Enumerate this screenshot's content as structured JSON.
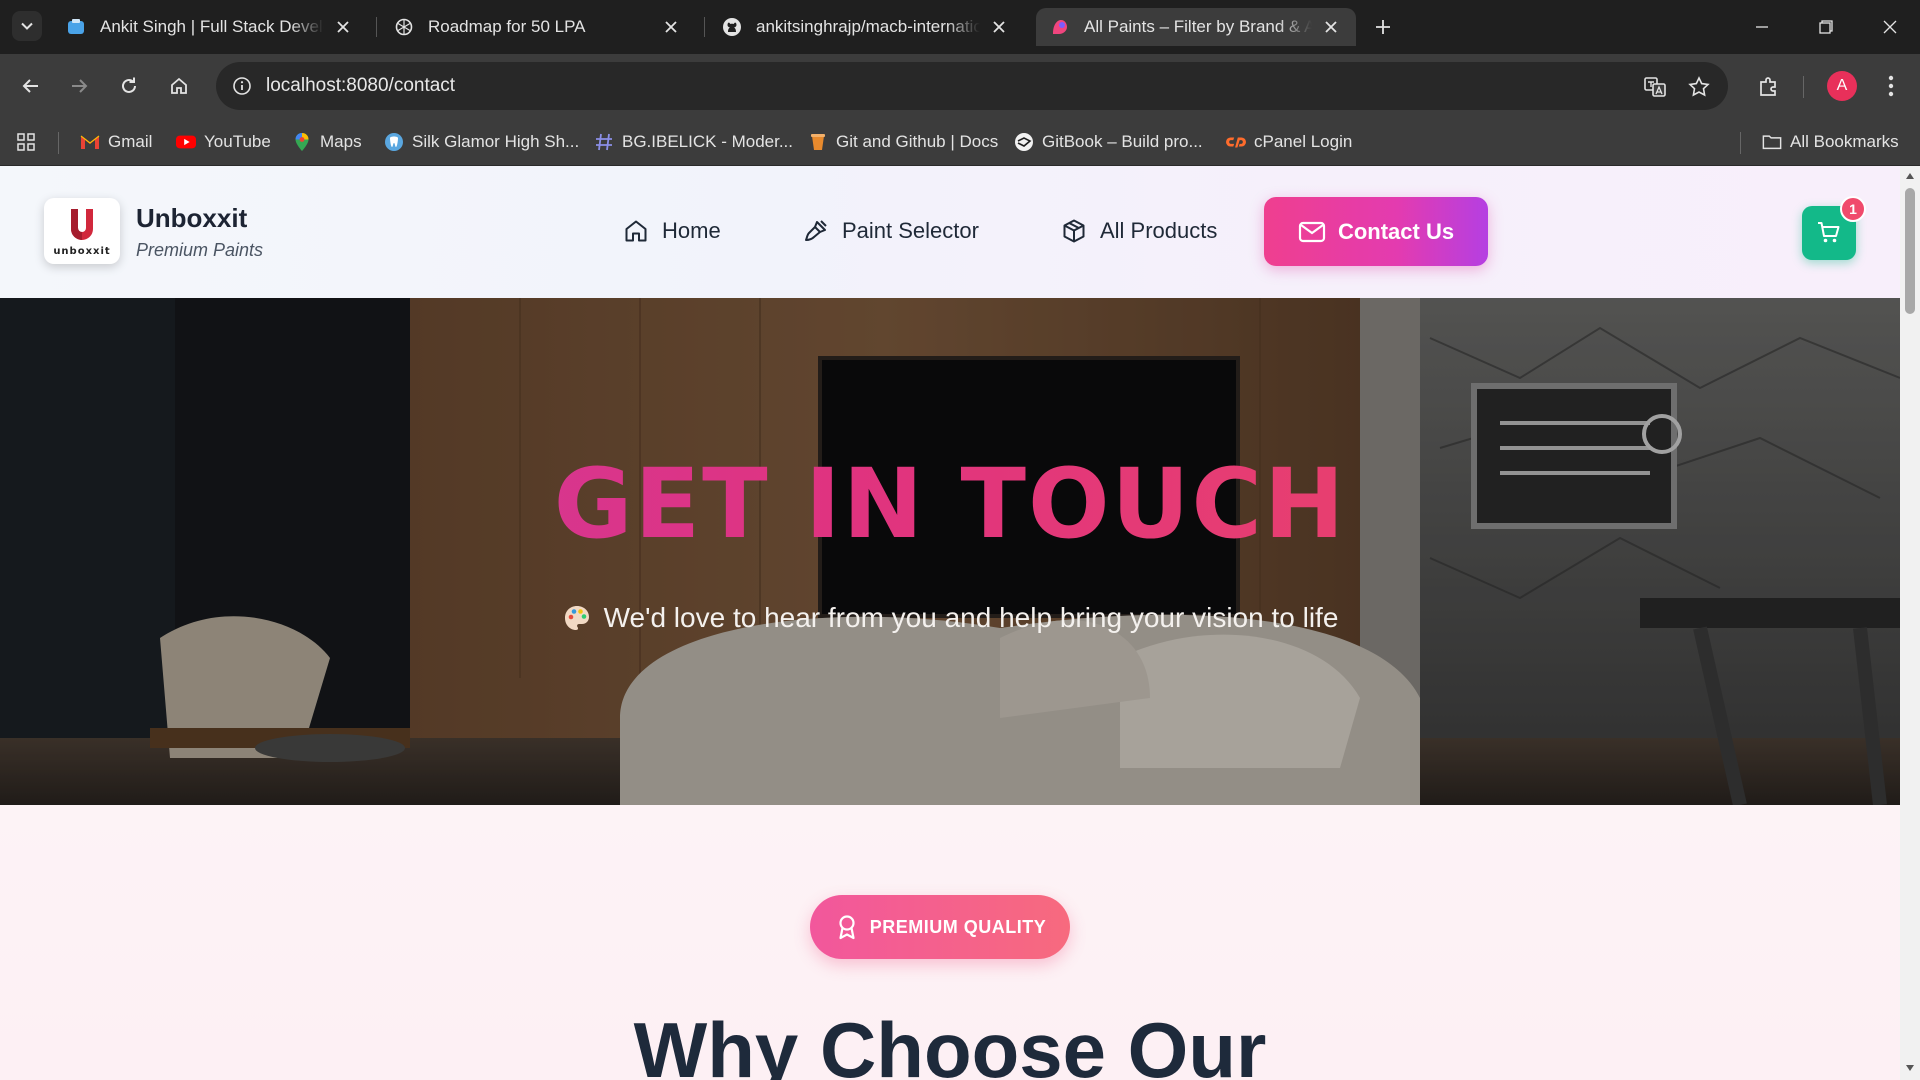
{
  "browser": {
    "tabs": [
      {
        "title": "Ankit Singh | Full Stack Developer"
      },
      {
        "title": "Roadmap for 50 LPA"
      },
      {
        "title": "ankitsinghrajp/macb-international"
      },
      {
        "title": "All Paints – Filter by Brand & Application"
      }
    ],
    "url": "localhost:8080/contact",
    "avatar_letter": "A",
    "bookmarks": [
      {
        "label": "Gmail"
      },
      {
        "label": "YouTube"
      },
      {
        "label": "Maps"
      },
      {
        "label": "Silk Glamor High Sh..."
      },
      {
        "label": "BG.IBELICK - Moder..."
      },
      {
        "label": "Git and Github | Docs"
      },
      {
        "label": "GitBook – Build pro..."
      },
      {
        "label": "cPanel Login"
      }
    ],
    "all_bookmarks": "All Bookmarks"
  },
  "site": {
    "logo_word": "unboxxit",
    "brand_name": "Unboxxit",
    "brand_sub": "Premium Paints",
    "nav": {
      "home": "Home",
      "paint_selector": "Paint Selector",
      "all_products": "All Products",
      "contact": "Contact Us"
    },
    "cart_count": "1",
    "colors": {
      "accent_pink": "#ef3f8f",
      "accent_purple": "#b53fe2",
      "cart_green": "#13b989"
    }
  },
  "hero": {
    "title": "GET IN TOUCH",
    "subtitle": "We'd love to hear from you and help bring your vision to life"
  },
  "section": {
    "badge": "PREMIUM QUALITY",
    "title": "Why Choose Our"
  }
}
